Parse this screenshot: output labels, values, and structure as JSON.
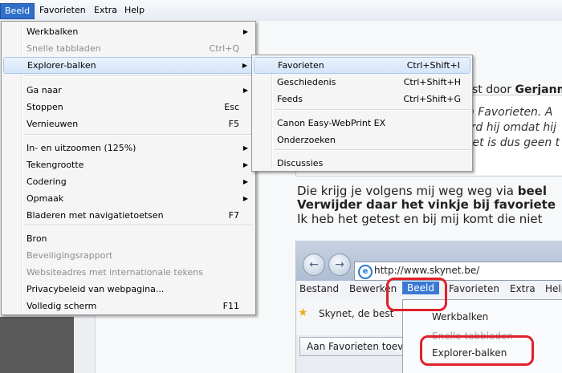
{
  "menubar": {
    "items": [
      "Beeld",
      "Favorieten",
      "Extra",
      "Help"
    ]
  },
  "background": {
    "author_prefix": "st door",
    "author_name": "Gerjanm",
    "quote_lines": [
      "in Favorieten. A",
      "erd hij omdat hij",
      "Het is dus geen t"
    ],
    "para_line1_a": "Die krijg je volgens mij weg weg via",
    "para_line1_b": "beel",
    "para_line2": "Verwijder daar het vinkje bij favoriete",
    "para_line3": "Ik heb het getest en bij mij komt die niet"
  },
  "screenshot": {
    "url": "http://www.skynet.be/",
    "menu": [
      "Bestand",
      "Bewerken",
      "Beeld",
      "Favorieten",
      "Extra",
      "Help"
    ],
    "fav_link": "Skynet, de best",
    "add_favorites": "Aan Favorieten toev",
    "dropdown": [
      "Werkbalken",
      "Snelle tabbladen",
      "Explorer-balken"
    ]
  },
  "beeld_menu": {
    "items": [
      {
        "label": "Werkbalken",
        "shortcut": "",
        "submenu": true,
        "disabled": false
      },
      {
        "label": "Snelle tabbladen",
        "shortcut": "Ctrl+Q",
        "submenu": false,
        "disabled": true
      },
      {
        "label": "Explorer-balken",
        "shortcut": "",
        "submenu": true,
        "disabled": false,
        "highlighted": true
      },
      {
        "label": "Ga naar",
        "shortcut": "",
        "submenu": true,
        "disabled": false
      },
      {
        "label": "Stoppen",
        "shortcut": "Esc",
        "submenu": false,
        "disabled": false
      },
      {
        "label": "Vernieuwen",
        "shortcut": "F5",
        "submenu": false,
        "disabled": false
      },
      {
        "label": "In- en uitzoomen (125%)",
        "shortcut": "",
        "submenu": true,
        "disabled": false
      },
      {
        "label": "Tekengrootte",
        "shortcut": "",
        "submenu": true,
        "disabled": false
      },
      {
        "label": "Codering",
        "shortcut": "",
        "submenu": true,
        "disabled": false
      },
      {
        "label": "Opmaak",
        "shortcut": "",
        "submenu": true,
        "disabled": false
      },
      {
        "label": "Bladeren met navigatietoetsen",
        "shortcut": "F7",
        "submenu": false,
        "disabled": false
      },
      {
        "label": "Bron",
        "shortcut": "",
        "submenu": false,
        "disabled": false
      },
      {
        "label": "Beveiligingsrapport",
        "shortcut": "",
        "submenu": false,
        "disabled": true
      },
      {
        "label": "Websiteadres met internationale tekens",
        "shortcut": "",
        "submenu": false,
        "disabled": true
      },
      {
        "label": "Privacybeleid van webpagina...",
        "shortcut": "",
        "submenu": false,
        "disabled": false
      },
      {
        "label": "Volledig scherm",
        "shortcut": "F11",
        "submenu": false,
        "disabled": false
      }
    ]
  },
  "explorer_submenu": {
    "items": [
      {
        "label": "Favorieten",
        "shortcut": "Ctrl+Shift+I",
        "highlighted": true
      },
      {
        "label": "Geschiedenis",
        "shortcut": "Ctrl+Shift+H"
      },
      {
        "label": "Feeds",
        "shortcut": "Ctrl+Shift+G"
      },
      {
        "label": "Canon Easy-WebPrint EX",
        "shortcut": ""
      },
      {
        "label": "Onderzoeken",
        "shortcut": ""
      },
      {
        "label": "Discussies",
        "shortcut": ""
      }
    ]
  },
  "colors": {
    "menu_active": "#2f6fc9",
    "highlight_ring": "#e0202a"
  }
}
